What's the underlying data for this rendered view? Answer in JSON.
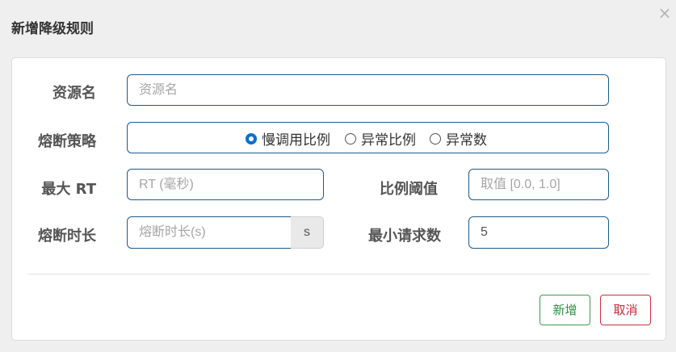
{
  "dialog": {
    "title": "新增降级规则",
    "close_glyph": "×"
  },
  "form": {
    "resource": {
      "label": "资源名",
      "placeholder": "资源名",
      "value": ""
    },
    "strategy": {
      "label": "熔断策略",
      "options": [
        "慢调用比例",
        "异常比例",
        "异常数"
      ],
      "selected": "慢调用比例"
    },
    "max_rt": {
      "label": "最大 RT",
      "placeholder": "RT (毫秒)",
      "value": ""
    },
    "ratio_threshold": {
      "label": "比例阈值",
      "placeholder": "取值 [0.0, 1.0]",
      "value": ""
    },
    "duration": {
      "label": "熔断时长",
      "placeholder": "熔断时长(s)",
      "value": "",
      "unit": "s"
    },
    "min_requests": {
      "label": "最小请求数",
      "placeholder": "",
      "value": "5"
    }
  },
  "buttons": {
    "add": "新增",
    "cancel": "取消"
  },
  "colors": {
    "field_border": "#1e5a8a",
    "radio_selected": "#0a6ed1",
    "add_button": "#2f8f42",
    "cancel_button": "#c42b36"
  },
  "icons": {
    "close": "close-icon"
  }
}
